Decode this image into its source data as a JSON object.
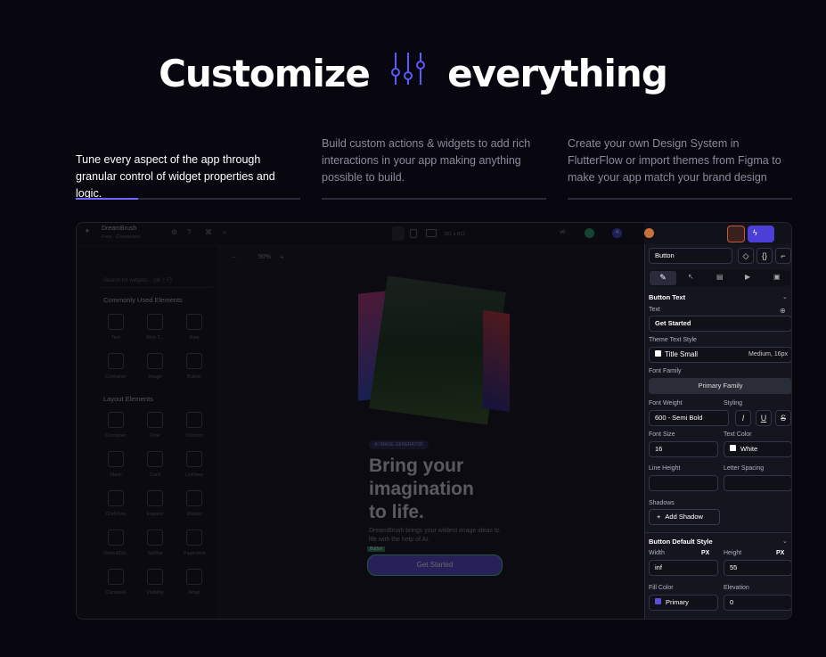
{
  "hero": {
    "title_left": "Customize",
    "title_right": "everything"
  },
  "features": [
    {
      "text": "Tune every aspect of the app through granular control of widget properties and logic.",
      "active": true
    },
    {
      "text": "Build custom actions & widgets to add rich interactions in your app making anything possible to build.",
      "active": false
    },
    {
      "text": "Create your own Design System in FlutterFlow or import themes from Figma to make your app match your brand design",
      "active": false
    }
  ],
  "editor": {
    "project_name": "DreamBrush",
    "project_sub": "Free · Connected",
    "zoom": "90%",
    "device_size": "391 x 812",
    "version": "v6",
    "badge_count": "4",
    "search_placeholder": "Search for widgets... (⌘ + F)",
    "common_header": "Commonly Used Elements",
    "layout_header": "Layout Elements",
    "common_items": [
      "Text",
      "Rich T...",
      "Row",
      "Container",
      "Image",
      "Button"
    ],
    "layout_items": [
      "Container",
      "Row",
      "Column",
      "Stack",
      "Card",
      "ListView",
      "GridView",
      "Expand",
      "Divider",
      "VerticalDiv..",
      "TabBar",
      "PageView",
      "Carousel",
      "Visibility",
      "Wrap"
    ]
  },
  "phone": {
    "badge": "AI IMAGE GENERATOR",
    "headline": [
      "Bring your",
      "imagination",
      "to life."
    ],
    "sub": "DreamBrush brings your wildest image ideas to life with the help of AI.",
    "button_tag": "Button",
    "button": "Get Started"
  },
  "props": {
    "widget": "Button",
    "section1": "Button Text",
    "text_label": "Text",
    "text_value": "Get Started",
    "theme_label": "Theme Text Style",
    "theme_value": "Title Small",
    "theme_meta": "Medium, 16px",
    "font_family_label": "Font Family",
    "font_family_value": "Primary Family",
    "font_weight_label": "Font Weight",
    "font_weight_value": "600 - Semi Bold",
    "styling_label": "Styling",
    "font_size_label": "Font Size",
    "font_size_value": "16",
    "text_color_label": "Text Color",
    "text_color_value": "White",
    "line_height_label": "Line Height",
    "letter_spacing_label": "Letter Spacing",
    "shadows_label": "Shadows",
    "add_shadow": "Add Shadow",
    "section2": "Button Default Style",
    "width_label": "Width",
    "width_value": "inf",
    "height_label": "Height",
    "height_value": "55",
    "unit": "PX",
    "fill_label": "Fill Color",
    "fill_value": "Primary",
    "elevation_label": "Elevation",
    "elevation_value": "0"
  },
  "colors": {
    "accent": "#7166ff",
    "primary": "#5b4fd8",
    "bg": "#08070f"
  }
}
